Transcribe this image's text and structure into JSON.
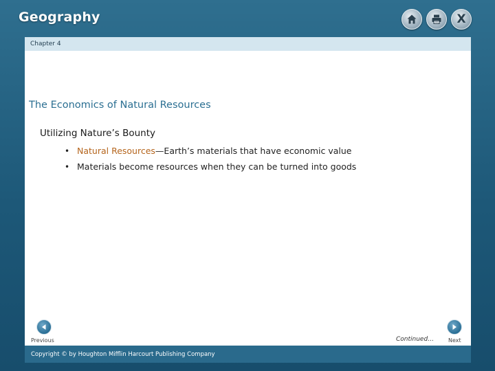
{
  "header": {
    "title": "Geography",
    "buttons": [
      {
        "icon": "home-icon"
      },
      {
        "icon": "printer-icon"
      },
      {
        "icon": "close-icon",
        "label": "X"
      }
    ]
  },
  "chapter": {
    "label": "Chapter 4"
  },
  "content": {
    "heading": "The Economics of Natural Resources",
    "subheading": "Utilizing Nature’s Bounty",
    "bullets": [
      {
        "term": "Natural Resources",
        "text": "—Earth’s materials that have economic value"
      },
      {
        "text": "Materials become resources when they can be turned into goods"
      }
    ]
  },
  "nav": {
    "previous_label": "Previous",
    "next_label": "Next",
    "continued": "Continued…"
  },
  "footer": {
    "copyright": "Copyright © by Houghton Mifflin Harcourt Publishing Company"
  },
  "colors": {
    "frame": "#1d5878",
    "heading": "#2b6f92",
    "term": "#b5651d",
    "chapter_bar": "#d4e6ef",
    "footer_bar": "#2a6a8c"
  }
}
